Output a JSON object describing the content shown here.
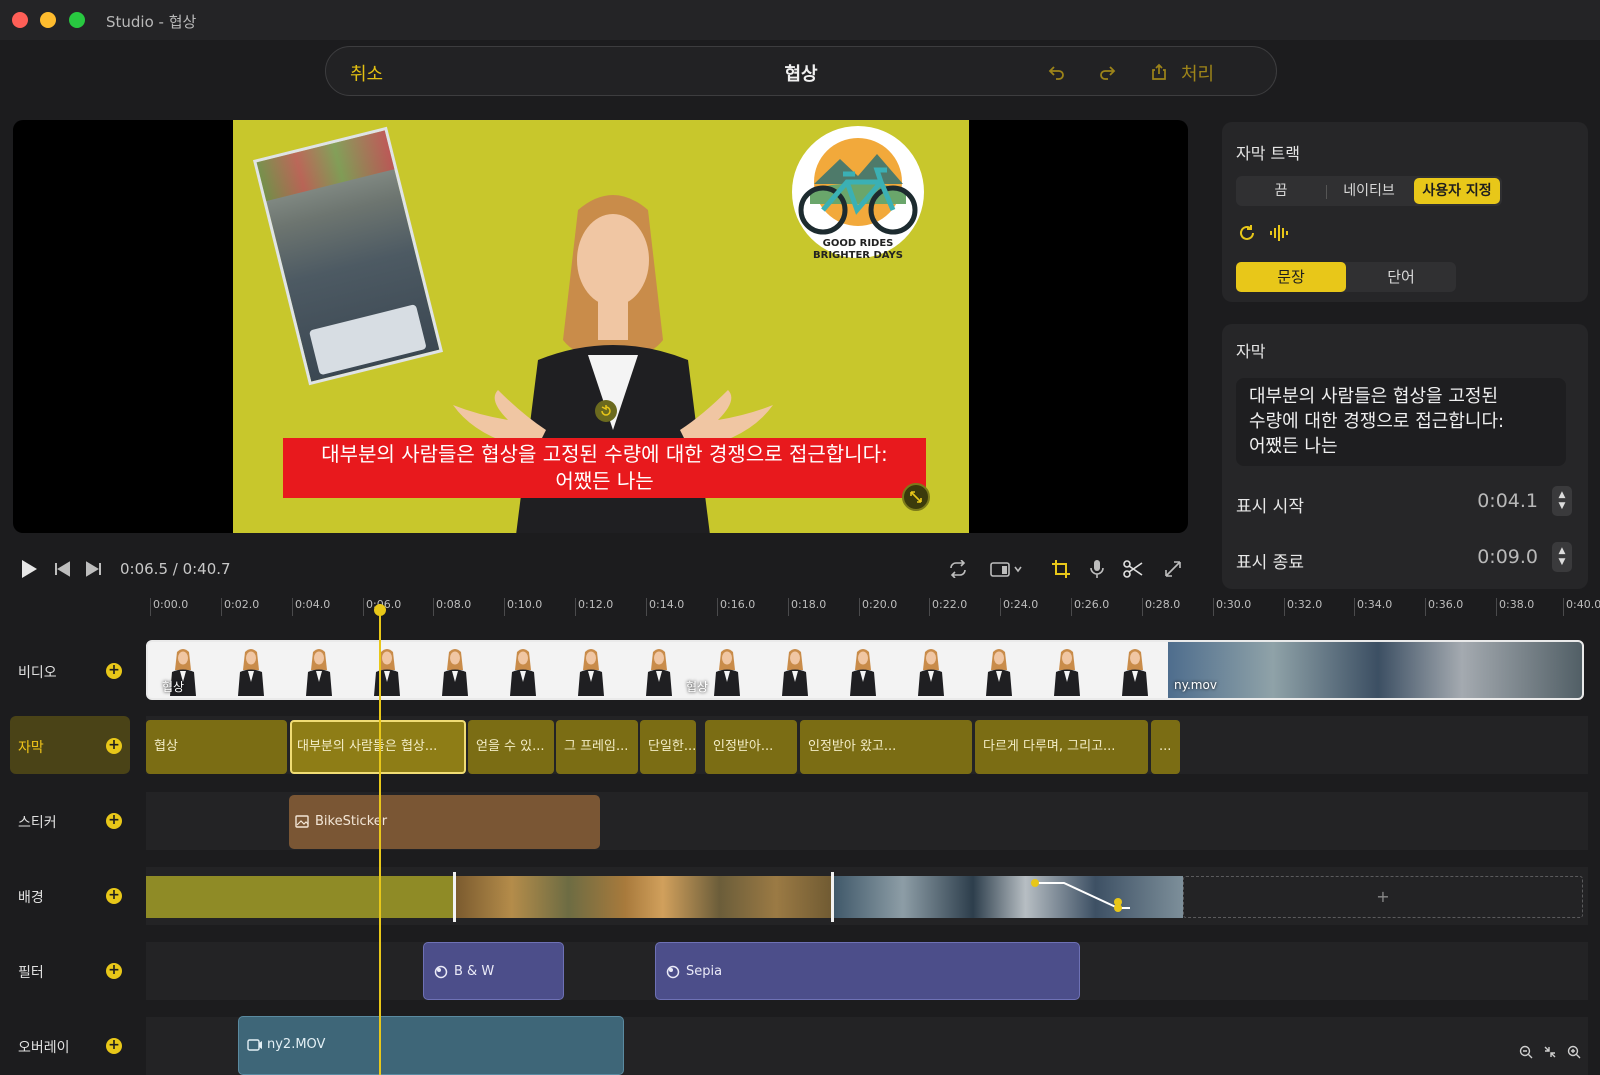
{
  "window": {
    "title": "Studio - 협상"
  },
  "toolbar": {
    "cancel_label": "취소",
    "title": "협상",
    "process_label": "처리",
    "undo_icon": "undo-icon",
    "redo_icon": "redo-icon",
    "export_icon": "export-icon"
  },
  "preview": {
    "caption": "대부분의 사람들은 협상을 고정된 수량에 대한 경쟁으로 접근합니다:\n어쨌든 나는",
    "sticker_text_line1": "GOOD RIDES",
    "sticker_text_line2": "BRIGHTER DAYS"
  },
  "player": {
    "timecode": "0:06.5 / 0:40.7"
  },
  "subtitle_track_panel": {
    "heading": "자막 트랙",
    "modes": [
      "끔",
      "네이티브",
      "사용자 지정"
    ],
    "selected_mode": "사용자 지정",
    "units": [
      "문장",
      "단어"
    ],
    "selected_unit": "문장"
  },
  "subtitle_panel": {
    "heading": "자막",
    "text": "대부분의 사람들은 협상을 고정된\n수량에 대한 경쟁으로 접근합니다:\n어쨌든 나는",
    "start_label": "표시 시작",
    "start_value": "0:04.1",
    "end_label": "표시 종료",
    "end_value": "0:09.0"
  },
  "timeline": {
    "ruler": [
      "0:00.0",
      "0:02.0",
      "0:04.0",
      "0:06.0",
      "0:08.0",
      "0:10.0",
      "0:12.0",
      "0:14.0",
      "0:16.0",
      "0:18.0",
      "0:20.0",
      "0:22.0",
      "0:24.0",
      "0:26.0",
      "0:28.0",
      "0:30.0",
      "0:32.0",
      "0:34.0",
      "0:36.0",
      "0:38.0",
      "0:40.0"
    ],
    "tracks": [
      "비디오",
      "자막",
      "스티커",
      "배경",
      "필터",
      "오버레이"
    ],
    "active_track": "자막",
    "video_clips": [
      "협상",
      "협상",
      "ny.mov"
    ],
    "subtitle_clips": [
      "협상",
      "대부분의 사람들은 협상...",
      "얻을 수 있...",
      "그 프레임...",
      "단일한...",
      "인정받아...",
      "인정받아 왔고...",
      "다르게 다루며, 그리고...",
      "..."
    ],
    "sticker_clip": "BikeSticker",
    "background_add": "+",
    "filter_clips": [
      "B & W",
      "Sepia"
    ],
    "overlay_clip": "ny2.MOV",
    "playhead_time": "0:06.5"
  },
  "colors": {
    "accent": "#e8c719",
    "caption_bg": "#e8191d",
    "stage_bg": "#c8c72c",
    "filter": "#4c4e8a",
    "overlay": "#3e6678"
  }
}
